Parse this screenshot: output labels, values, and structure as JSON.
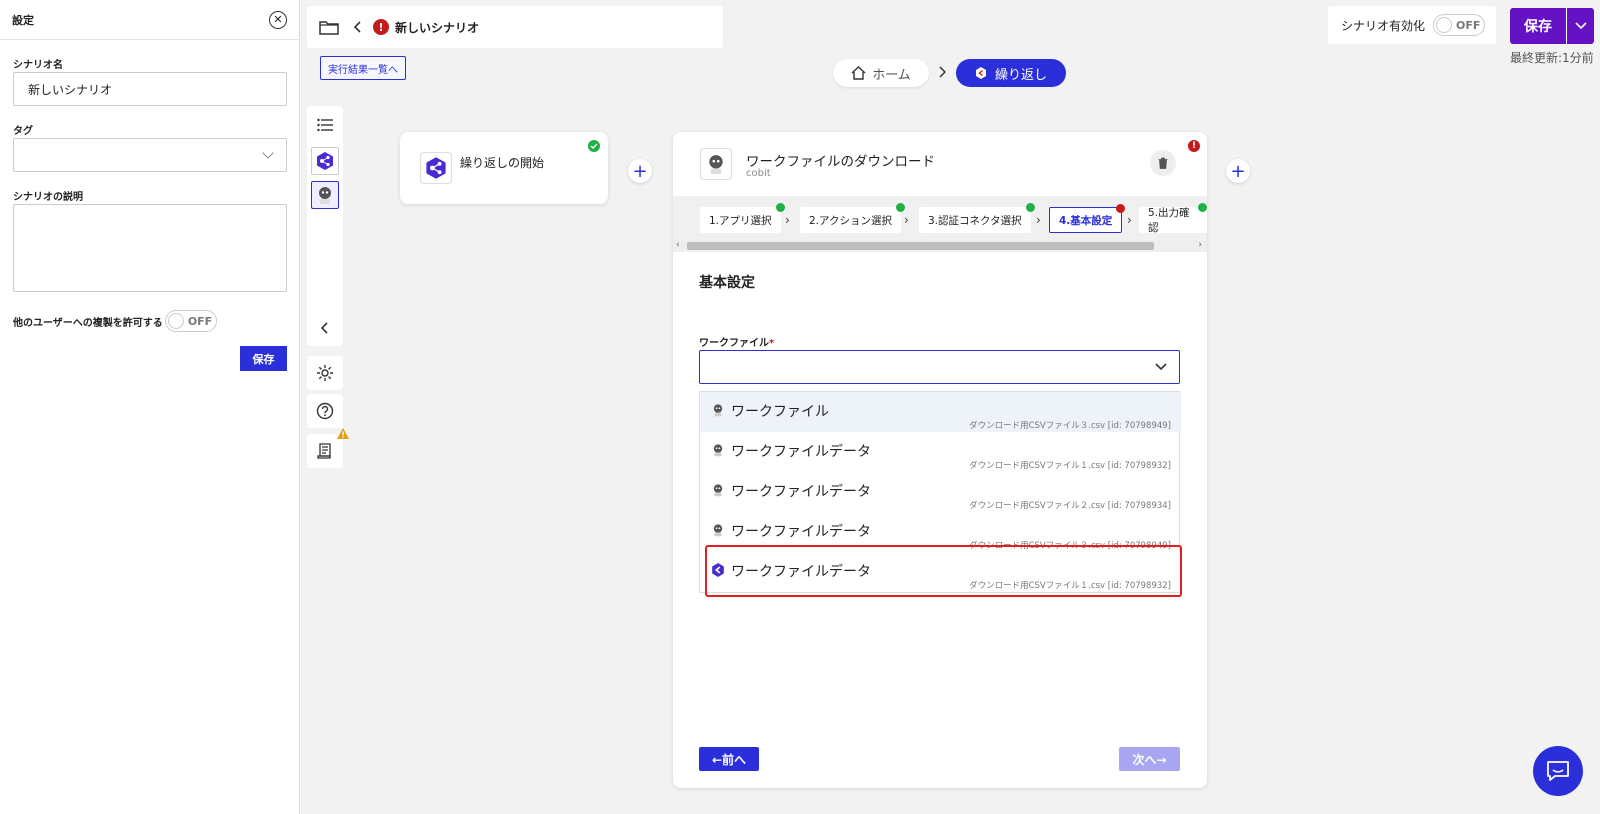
{
  "settings": {
    "title": "設定",
    "scenario_name_label": "シナリオ名",
    "scenario_name_value": "新しいシナリオ",
    "tag_label": "タグ",
    "description_label": "シナリオの説明",
    "allow_copy_label": "他のユーザーへの複製を許可する",
    "allow_copy_toggle": "OFF",
    "save_label": "保存"
  },
  "topbar": {
    "scenario_title": "新しいシナリオ",
    "error_mark": "!",
    "results_link": "実行結果一覧へ"
  },
  "breadcrumb": {
    "home": "ホーム",
    "current": "繰り返し"
  },
  "header_right": {
    "enable_label": "シナリオ有効化",
    "enable_toggle": "OFF",
    "save_label": "保存",
    "last_updated": "最終更新:1分前"
  },
  "flow": {
    "start_card_title": "繰り返しの開始",
    "main_card": {
      "title": "ワークファイルのダウンロード",
      "subtitle": "cobit",
      "error_mark": "!",
      "steps": [
        {
          "label": "1.アプリ選択",
          "status": "ok"
        },
        {
          "label": "2.アクション選択",
          "status": "ok"
        },
        {
          "label": "3.認証コネクタ選択",
          "status": "ok"
        },
        {
          "label": "4.基本設定",
          "status": "error"
        },
        {
          "label": "5.出力確認",
          "status": "ok"
        }
      ],
      "section_title": "基本設定",
      "workfile_label": "ワークファイル",
      "required_mark": "*",
      "options": [
        {
          "label": "ワークファイル",
          "sub": "ダウンロード用CSVファイル３.csv [id: 70798949]",
          "icon": "robot-icon"
        },
        {
          "label": "ワークファイルデータ",
          "sub": "ダウンロード用CSVファイル１.csv [id: 70798932]",
          "icon": "robot-icon"
        },
        {
          "label": "ワークファイルデータ",
          "sub": "ダウンロード用CSVファイル２.csv [id: 70798934]",
          "icon": "robot-icon"
        },
        {
          "label": "ワークファイルデータ",
          "sub": "ダウンロード用CSVファイル３.csv [id: 70798949]",
          "icon": "robot-icon"
        },
        {
          "label": "ワークファイルデータ",
          "sub": "ダウンロード用CSVファイル１.csv [id: 70798932]",
          "icon": "loop-icon"
        }
      ],
      "prev_label": "←前へ",
      "next_label": "次へ→"
    }
  },
  "colors": {
    "accent": "#2a2fd9",
    "save_purple": "#6412c4",
    "error": "#c41a1a",
    "ok": "#1fb045",
    "highlight_frame": "#e02020"
  }
}
